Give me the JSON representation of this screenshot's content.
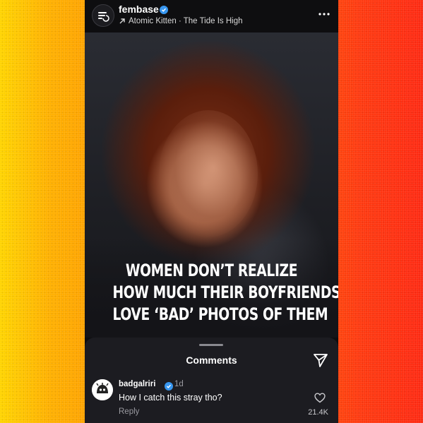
{
  "colors": {
    "background_left": "#ffd400",
    "background_right": "#ff2a12",
    "app_background": "#0e0e10",
    "sheet_background": "#1c1c21",
    "verified_blue": "#3897f0"
  },
  "post": {
    "account_name": "fembase",
    "verified": true,
    "music_icon": "arrow-up-right-icon",
    "music_label": "Atomic Kitten · The Tide Is High",
    "more_icon": "more-horizontal-icon",
    "headline_lines": [
      "WOMEN DON’T REALIZE",
      "HOW MUCH THEIR BOYFRIENDS",
      "LOVE ‘BAD’ PHOTOS OF THEM"
    ]
  },
  "comments_sheet": {
    "title": "Comments",
    "send_icon": "send-icon",
    "comment": {
      "username": "badgalriri",
      "verified": true,
      "age": "1d",
      "text": "How I catch this stray tho?",
      "reply_label": "Reply",
      "like_icon": "heart-outline-icon",
      "like_count": "21.4K"
    }
  }
}
